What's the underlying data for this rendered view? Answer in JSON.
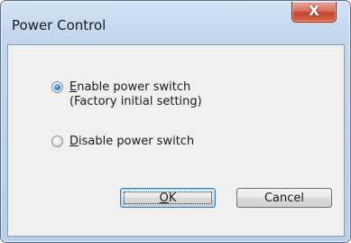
{
  "window": {
    "title": "Power Control",
    "close_label": "X"
  },
  "options": {
    "enable": {
      "accel": "E",
      "rest": "nable power switch",
      "sub": "(Factory initial setting)",
      "checked": true
    },
    "disable": {
      "accel": "D",
      "rest": "isable power switch",
      "checked": false
    }
  },
  "buttons": {
    "ok": {
      "accel": "O",
      "rest": "K"
    },
    "cancel": "Cancel"
  }
}
